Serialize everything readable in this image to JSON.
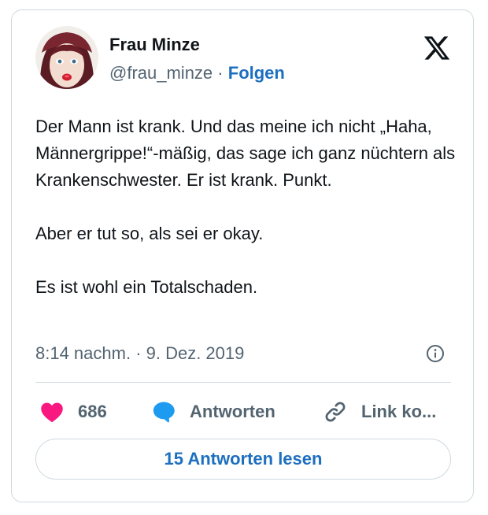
{
  "author": {
    "display_name": "Frau Minze",
    "handle": "@frau_minze",
    "separator": "·",
    "follow_label": "Folgen"
  },
  "tweet": {
    "paragraphs": [
      "Der Mann ist krank. Und das meine ich nicht „Haha, Männergrippe!“-mäßig, das sage ich ganz nüchtern als Krankenschwester. Er ist krank. Punkt.",
      "Aber er tut so, als sei er okay.",
      "Es ist wohl ein Totalschaden."
    ],
    "timestamp": "8:14 nachm. · 9. Dez. 2019"
  },
  "actions": {
    "like_count": "686",
    "reply_label": "Antworten",
    "link_label": "Link ko..."
  },
  "read_replies_label": "15 Antworten lesen",
  "colors": {
    "link_blue": "#1d6fbf",
    "like_pink": "#f91880",
    "reply_blue": "#1d9bf0",
    "muted": "#536471",
    "border": "#cfd9de"
  },
  "icons": {
    "brand": "x-logo-icon",
    "info": "info-icon",
    "like": "heart-icon",
    "reply": "speech-bubble-icon",
    "link": "link-icon"
  }
}
